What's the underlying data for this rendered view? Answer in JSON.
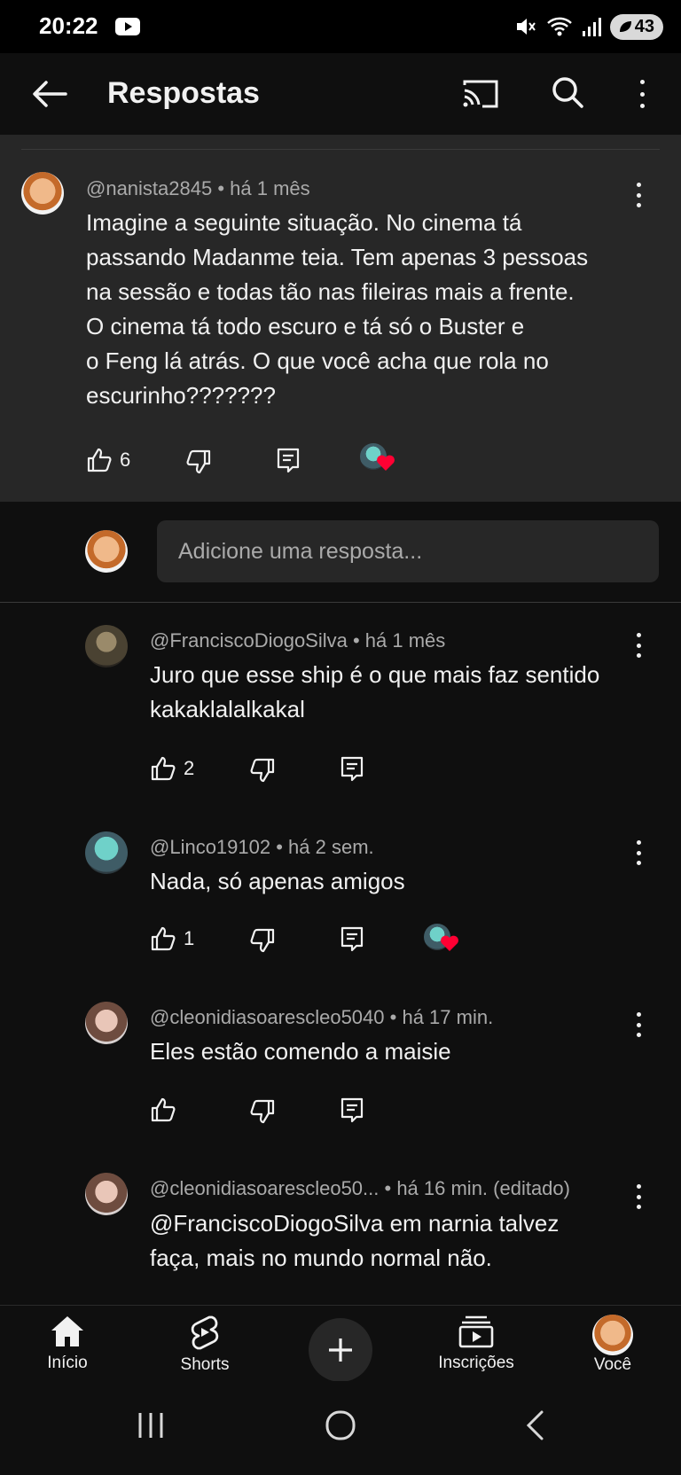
{
  "status": {
    "time": "20:22",
    "battery": "43"
  },
  "header": {
    "title": "Respostas"
  },
  "main_comment": {
    "author": "@nanista2845",
    "time": "há 1 mês",
    "text_lines": [
      "Imagine a seguinte situação. No cinema tá",
      "passando Madanme teia. Tem apenas 3 pessoas",
      "na sessão e todas tão nas fileiras mais a frente.",
      "O cinema tá todo escuro e tá só o Buster e",
      "o Feng lá atrás. O que você acha que rola no",
      "escurinho???????"
    ],
    "likes": "6"
  },
  "reply_input": {
    "placeholder": "Adicione uma resposta..."
  },
  "replies": [
    {
      "author": "@FranciscoDiogoSilva",
      "time": "há 1 mês",
      "text_lines": [
        "Juro que esse ship é o que mais faz sentido",
        "kakaklalalkakal"
      ],
      "likes": "2"
    },
    {
      "author": "@Linco19102",
      "time": "há 2 sem.",
      "text_lines": [
        "Nada, só apenas amigos"
      ],
      "likes": "1"
    },
    {
      "author": "@cleonidiasoarescleo5040",
      "time": "há 17 min.",
      "text_lines": [
        "Eles estão comendo a maisie"
      ],
      "likes": ""
    },
    {
      "author": "@cleonidiasoarescleo50...",
      "time": "há 16 min. (editado)",
      "text_lines": [
        "@FranciscoDiogoSilva em narnia talvez",
        "faça, mais no mundo normal não."
      ],
      "likes": ""
    }
  ],
  "bottom_nav": {
    "home": "Início",
    "shorts": "Shorts",
    "subscriptions": "Inscrições",
    "you": "Você"
  },
  "colors": {
    "background": "#0f0f0f",
    "surface": "#272727",
    "text": "#f1f1f1",
    "secondary_text": "#aaaaaa",
    "heart": "#ff0033"
  }
}
